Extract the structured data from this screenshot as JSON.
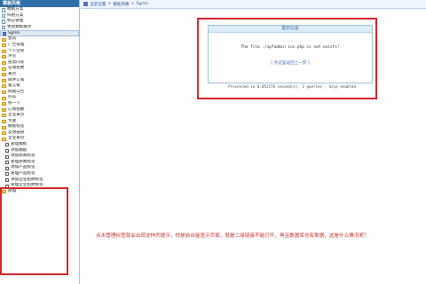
{
  "sidebar": {
    "header": "模板风格",
    "items": [
      {
        "label": "模板方案",
        "icon": "page-icon",
        "level": 1,
        "kind": "page"
      },
      {
        "label": "风格方案",
        "icon": "page-icon",
        "level": 1,
        "kind": "page"
      },
      {
        "label": "标记管理",
        "icon": "page-icon",
        "level": 1,
        "kind": "page"
      },
      {
        "label": "更新模板缓存",
        "icon": "page-icon",
        "level": 1,
        "kind": "page"
      },
      {
        "label": "Sgren",
        "icon": "page-icon",
        "level": 1,
        "kind": "selected"
      },
      {
        "label": "会员",
        "icon": "folder-icon",
        "level": 1,
        "kind": "folder"
      },
      {
        "label": "广告管理",
        "icon": "folder-icon",
        "level": 1,
        "kind": "folder"
      },
      {
        "label": "个人空间",
        "icon": "folder-icon",
        "level": 1,
        "kind": "folder"
      },
      {
        "label": "评论",
        "icon": "folder-icon",
        "level": 1,
        "kind": "folder"
      },
      {
        "label": "投票问卷",
        "icon": "folder-icon",
        "level": 1,
        "kind": "folder"
      },
      {
        "label": "在线招聘",
        "icon": "folder-icon",
        "level": 1,
        "kind": "folder"
      },
      {
        "label": "黄页",
        "icon": "folder-icon",
        "level": 1,
        "kind": "folder"
      },
      {
        "label": "邮件订阅",
        "icon": "folder-icon",
        "level": 1,
        "kind": "folder"
      },
      {
        "label": "留言板",
        "icon": "folder-icon",
        "level": 1,
        "kind": "folder"
      },
      {
        "label": "网站公告",
        "icon": "folder-icon",
        "level": 1,
        "kind": "folder"
      },
      {
        "label": "问答",
        "icon": "folder-icon",
        "level": 1,
        "kind": "folder"
      },
      {
        "label": "统一下",
        "icon": "folder-icon",
        "level": 1,
        "kind": "folder"
      },
      {
        "label": "心情指数",
        "icon": "folder-icon",
        "level": 1,
        "kind": "folder"
      },
      {
        "label": "企业黄页",
        "icon": "folder-icon",
        "level": 1,
        "kind": "folder"
      },
      {
        "label": "专题",
        "icon": "folder-icon",
        "level": 1,
        "kind": "folder"
      },
      {
        "label": "模板标签",
        "icon": "folder-icon",
        "level": 1,
        "kind": "folder"
      },
      {
        "label": "友情链接",
        "icon": "folder-icon",
        "level": 1,
        "kind": "folder"
      },
      {
        "label": "企业黄页",
        "icon": "folder-icon",
        "level": 1,
        "kind": "folder"
      },
      {
        "label": "管理模板",
        "icon": "checkbox-icon",
        "level": 2,
        "kind": "checkbox"
      },
      {
        "label": "添加模板",
        "icon": "checkbox-icon",
        "level": 2,
        "kind": "checkbox"
      },
      {
        "label": "添加新闻标签",
        "icon": "checkbox-icon",
        "level": 2,
        "kind": "checkbox"
      },
      {
        "label": "管理新闻标签",
        "icon": "checkbox-icon",
        "level": 2,
        "kind": "checkbox"
      },
      {
        "label": "添加产品标签",
        "icon": "checkbox-icon",
        "level": 2,
        "kind": "checkbox"
      },
      {
        "label": "管理产品标签",
        "icon": "checkbox-icon",
        "level": 2,
        "kind": "checkbox"
      },
      {
        "label": "添加企业招聘标签",
        "icon": "checkbox-icon",
        "level": 2,
        "kind": "checkbox"
      },
      {
        "label": "管理企业招聘标签",
        "icon": "checkbox-icon",
        "level": 2,
        "kind": "checkbox"
      },
      {
        "label": "商城",
        "icon": "folder-icon",
        "level": 1,
        "kind": "folder"
      }
    ]
  },
  "breadcrumb": {
    "items": [
      "当前位置",
      "模板风格",
      "Sgren"
    ]
  },
  "notice": {
    "title": "提示信息",
    "message": "The file ./upfadmin inc.php is not exists!",
    "link": "[ 点这里返回上一页 ]",
    "processed": "Processed in 0.052176 second(s), 2 queries , Gzip enabled"
  },
  "question": "点击管理标签就会出现这样的提示，你是前台能显示页面，就是二级链接不能打开，再且数据库也有数据，这是什么情况呢？",
  "colors": {
    "annotation_red": "#d8262a",
    "header_blue": "#2f6fa7",
    "question_red": "#c2302e"
  }
}
